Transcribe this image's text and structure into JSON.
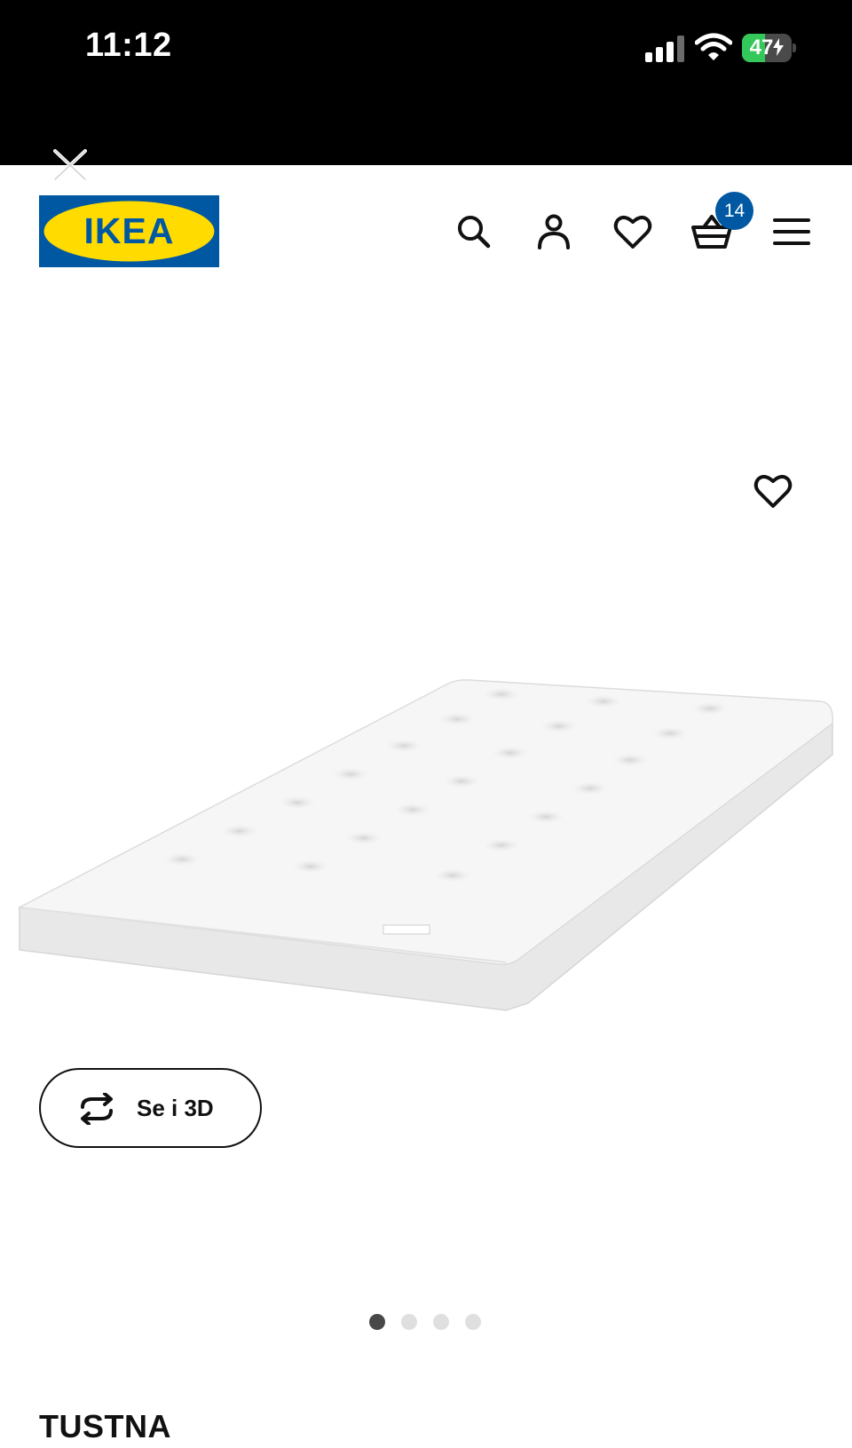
{
  "status_bar": {
    "time": "11:12",
    "battery_level": "47",
    "battery_percent": 47,
    "signal_icon": "cellular-signal-icon",
    "wifi_icon": "wifi-icon",
    "charging_icon": "bolt-icon"
  },
  "browser": {
    "close_icon": "close-icon"
  },
  "header": {
    "logo_text": "IKEA",
    "search_icon": "search-icon",
    "account_icon": "person-icon",
    "wishlist_icon": "heart-icon",
    "cart_icon": "basket-icon",
    "cart_count": "14",
    "menu_icon": "hamburger-menu-icon"
  },
  "product": {
    "image": "mattress",
    "favorite_icon": "heart-icon",
    "view_3d_label": "Se i 3D",
    "view_3d_icon": "rotate-icon",
    "carousel": {
      "total": 4,
      "active": 1
    },
    "name": "TUSTNA"
  },
  "colors": {
    "ikea_blue": "#0058a3",
    "ikea_yellow": "#ffdb00",
    "battery_green": "#34c759"
  }
}
